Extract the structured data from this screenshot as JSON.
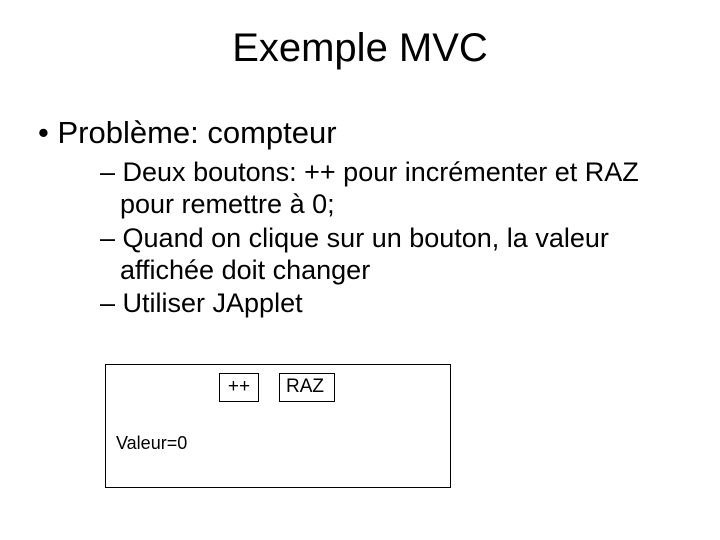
{
  "title": "Exemple MVC",
  "bullets": {
    "lvl1": "Problème: compteur",
    "lvl2": [
      "Deux boutons: ++ pour incrémenter et RAZ pour remettre à 0;",
      "Quand on clique sur un bouton, la valeur affichée doit changer",
      "Utiliser JApplet"
    ]
  },
  "app": {
    "buttons": {
      "increment": "++",
      "reset": "RAZ"
    },
    "value_label": "Valeur=0"
  }
}
